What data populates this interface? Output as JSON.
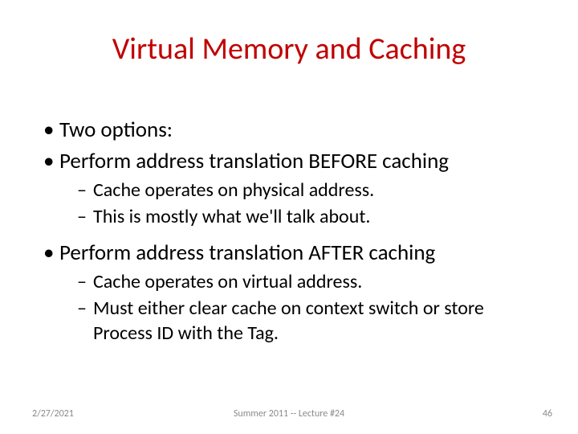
{
  "title": "Virtual Memory and Caching",
  "bullets": {
    "b1": "Two options:",
    "b2": "Perform address translation BEFORE caching",
    "b2a": "Cache operates on physical address.",
    "b2b": "This is mostly what we'll talk about.",
    "b3": "Perform address translation AFTER caching",
    "b3a": "Cache operates on virtual address.",
    "b3b": "Must either clear cache on context switch or store Process ID with the Tag."
  },
  "footer": {
    "date": "2/27/2021",
    "center": "Summer 2011 -- Lecture #24",
    "page": "46"
  }
}
